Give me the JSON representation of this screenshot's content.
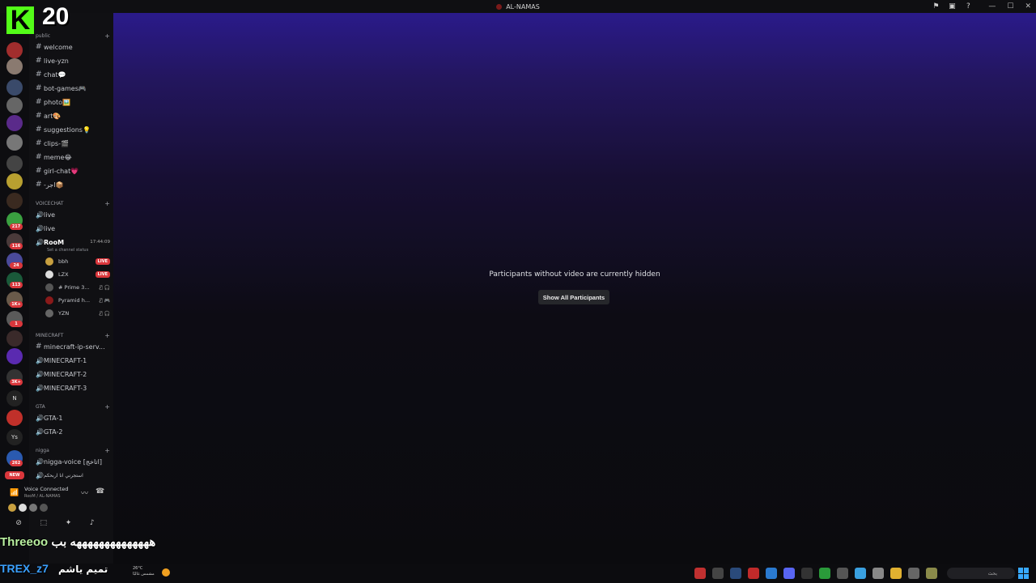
{
  "window": {
    "title": "AL-NAMAS"
  },
  "rail": {
    "badges": [
      "217",
      "116",
      "24",
      "113",
      "1K+",
      "1",
      "3K+",
      "262",
      "NEW"
    ],
    "letters": [
      "N",
      "Ys"
    ]
  },
  "sidebar": {
    "categories": {
      "public": "public",
      "voicechat": "VOICECHAT",
      "minecraft": "MINECRAFT",
      "gta": "GTA",
      "nigga": "nigga"
    },
    "text_channels": [
      "welcome",
      "live-yzn",
      "chat💬",
      "bot-games🎮",
      "photo🖼️",
      "art🎨",
      "suggestions💡",
      "clips-🎬",
      "meme😂",
      "girl-chat💗",
      "-اجر📦"
    ],
    "voice_channels": [
      "live",
      "live"
    ],
    "active_voice": {
      "name": "RooM",
      "time": "17:44:09",
      "status": "Set a channel status"
    },
    "voice_users": [
      {
        "name": "bbh",
        "live": "LIVE"
      },
      {
        "name": "LZX",
        "live": "LIVE"
      },
      {
        "name": "# Prime 3...",
        "live": ""
      },
      {
        "name": "Pyramid h...",
        "live": ""
      },
      {
        "name": "YZN",
        "live": ""
      }
    ],
    "minecraft_channels": [
      "minecraft-ip-serv...",
      "MINECRAFT-1",
      "MINECRAFT-2",
      "MINECRAFT-3"
    ],
    "gta_channels": [
      "GTA-1",
      "GTA-2"
    ],
    "nigga_channels": [
      "nigga-voice [اتاخج]",
      "استجرني انا اربحكم"
    ]
  },
  "voice_panel": {
    "title": "Voice Connected",
    "subtitle": "RooM / AL-NAMAS"
  },
  "stage": {
    "message": "Participants without video are currently hidden",
    "button": "Show All Participants"
  },
  "overlay": {
    "count": "20",
    "logo": "K",
    "name": "Threeoo",
    "name_msg": "ههههههههههههههه بب",
    "trex": "TREX_z7",
    "arabic": "تميم ياشم"
  },
  "taskbar": {
    "temp": "26°C",
    "weather_text": "مشمس غالبًا",
    "search": "بحث"
  },
  "colors": {
    "kick_green": "#53fc18",
    "live_red": "#da373c",
    "voice_green": "#23a55a"
  }
}
